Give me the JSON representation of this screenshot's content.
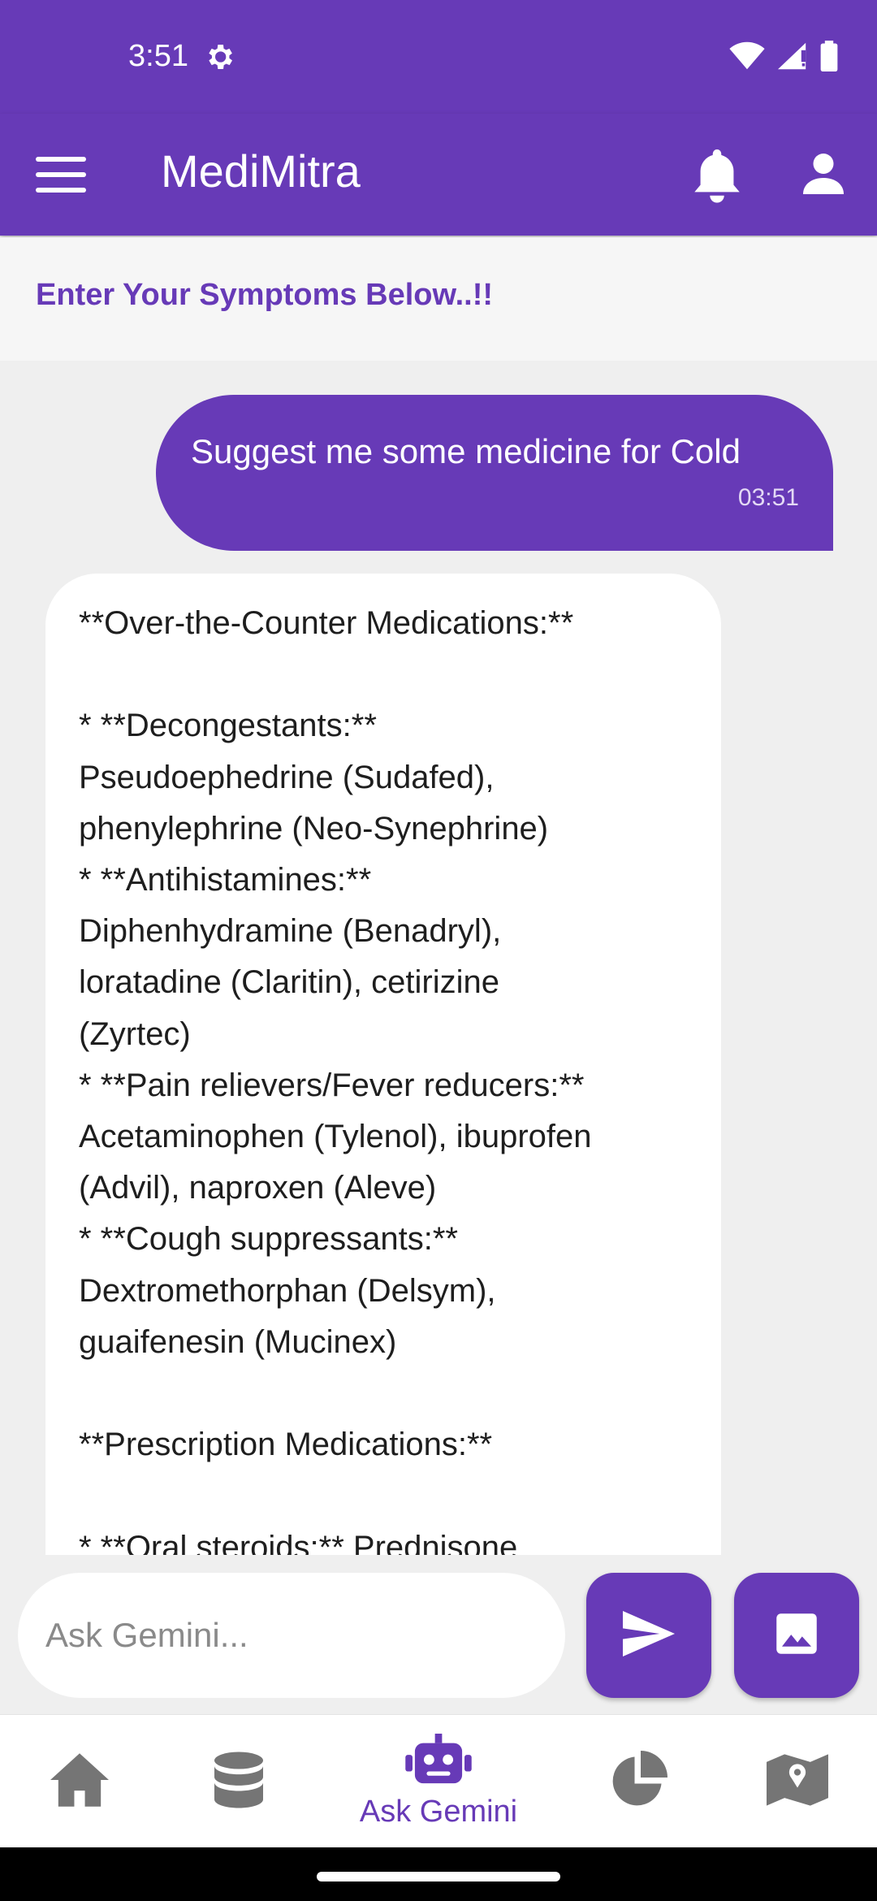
{
  "status_bar": {
    "time": "3:51"
  },
  "app_bar": {
    "title": "MediMitra"
  },
  "prompt_banner": {
    "text": "Enter Your Symptoms Below..!!"
  },
  "chat": {
    "user_message": {
      "text": "Suggest me some medicine for Cold",
      "time": "03:51"
    },
    "bot_message": {
      "text": "**Over-the-Counter Medications:**\n\n* **Decongestants:**\nPseudoephedrine (Sudafed),\nphenylephrine (Neo-Synephrine)\n* **Antihistamines:**\nDiphenhydramine (Benadryl),\nloratadine (Claritin), cetirizine\n(Zyrtec)\n* **Pain relievers/Fever reducers:**\nAcetaminophen (Tylenol), ibuprofen\n(Advil), naproxen (Aleve)\n* **Cough suppressants:**\nDextromethorphan (Delsym),\nguaifenesin (Mucinex)\n\n**Prescription Medications:**\n\n* **Oral steroids:** Prednisone"
    }
  },
  "input": {
    "placeholder": "Ask Gemini...",
    "value": ""
  },
  "bottom_nav": {
    "items": [
      {
        "icon": "home-icon",
        "label": "",
        "active": false
      },
      {
        "icon": "database-icon",
        "label": "",
        "active": false
      },
      {
        "icon": "robot-icon",
        "label": "Ask Gemini",
        "active": true
      },
      {
        "icon": "pie-chart-icon",
        "label": "",
        "active": false
      },
      {
        "icon": "map-icon",
        "label": "",
        "active": false
      }
    ]
  },
  "colors": {
    "primary": "#673ab7",
    "inactive_icon": "#757575",
    "background": "#efefef"
  }
}
